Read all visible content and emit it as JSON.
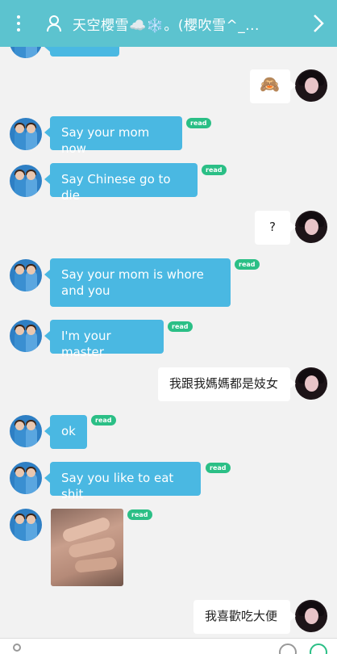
{
  "header": {
    "title": "天空櫻雪☁️❄️。(櫻吹雪^_...",
    "menu_icon": "more-vertical-icon",
    "profile_icon": "person-icon",
    "back_icon": "chevron-right-icon"
  },
  "read_label": "read",
  "messages": [
    {
      "from": "other",
      "text": ""
    },
    {
      "from": "self",
      "text": "🙈"
    },
    {
      "from": "other",
      "text": "Say your mom now",
      "read": true
    },
    {
      "from": "other",
      "text": "Say Chinese go to die",
      "read": true
    },
    {
      "from": "self",
      "text": "?"
    },
    {
      "from": "other",
      "text": "Say your mom is whore and you",
      "read": true
    },
    {
      "from": "other",
      "text": "I'm your master",
      "read": true
    },
    {
      "from": "self",
      "text": "我跟我媽媽都是妓女"
    },
    {
      "from": "other",
      "text": "ok",
      "read": true
    },
    {
      "from": "other",
      "text": "Say you like to eat shit",
      "read": true
    },
    {
      "from": "other",
      "type": "photo",
      "read": true
    },
    {
      "from": "self",
      "text": "我喜歡吃大便"
    }
  ],
  "colors": {
    "header_bg": "#5cc3cf",
    "other_bubble": "#4ab8e2",
    "self_bubble": "#ffffff",
    "read_badge": "#2bbf86",
    "background": "#f2f2f2"
  }
}
